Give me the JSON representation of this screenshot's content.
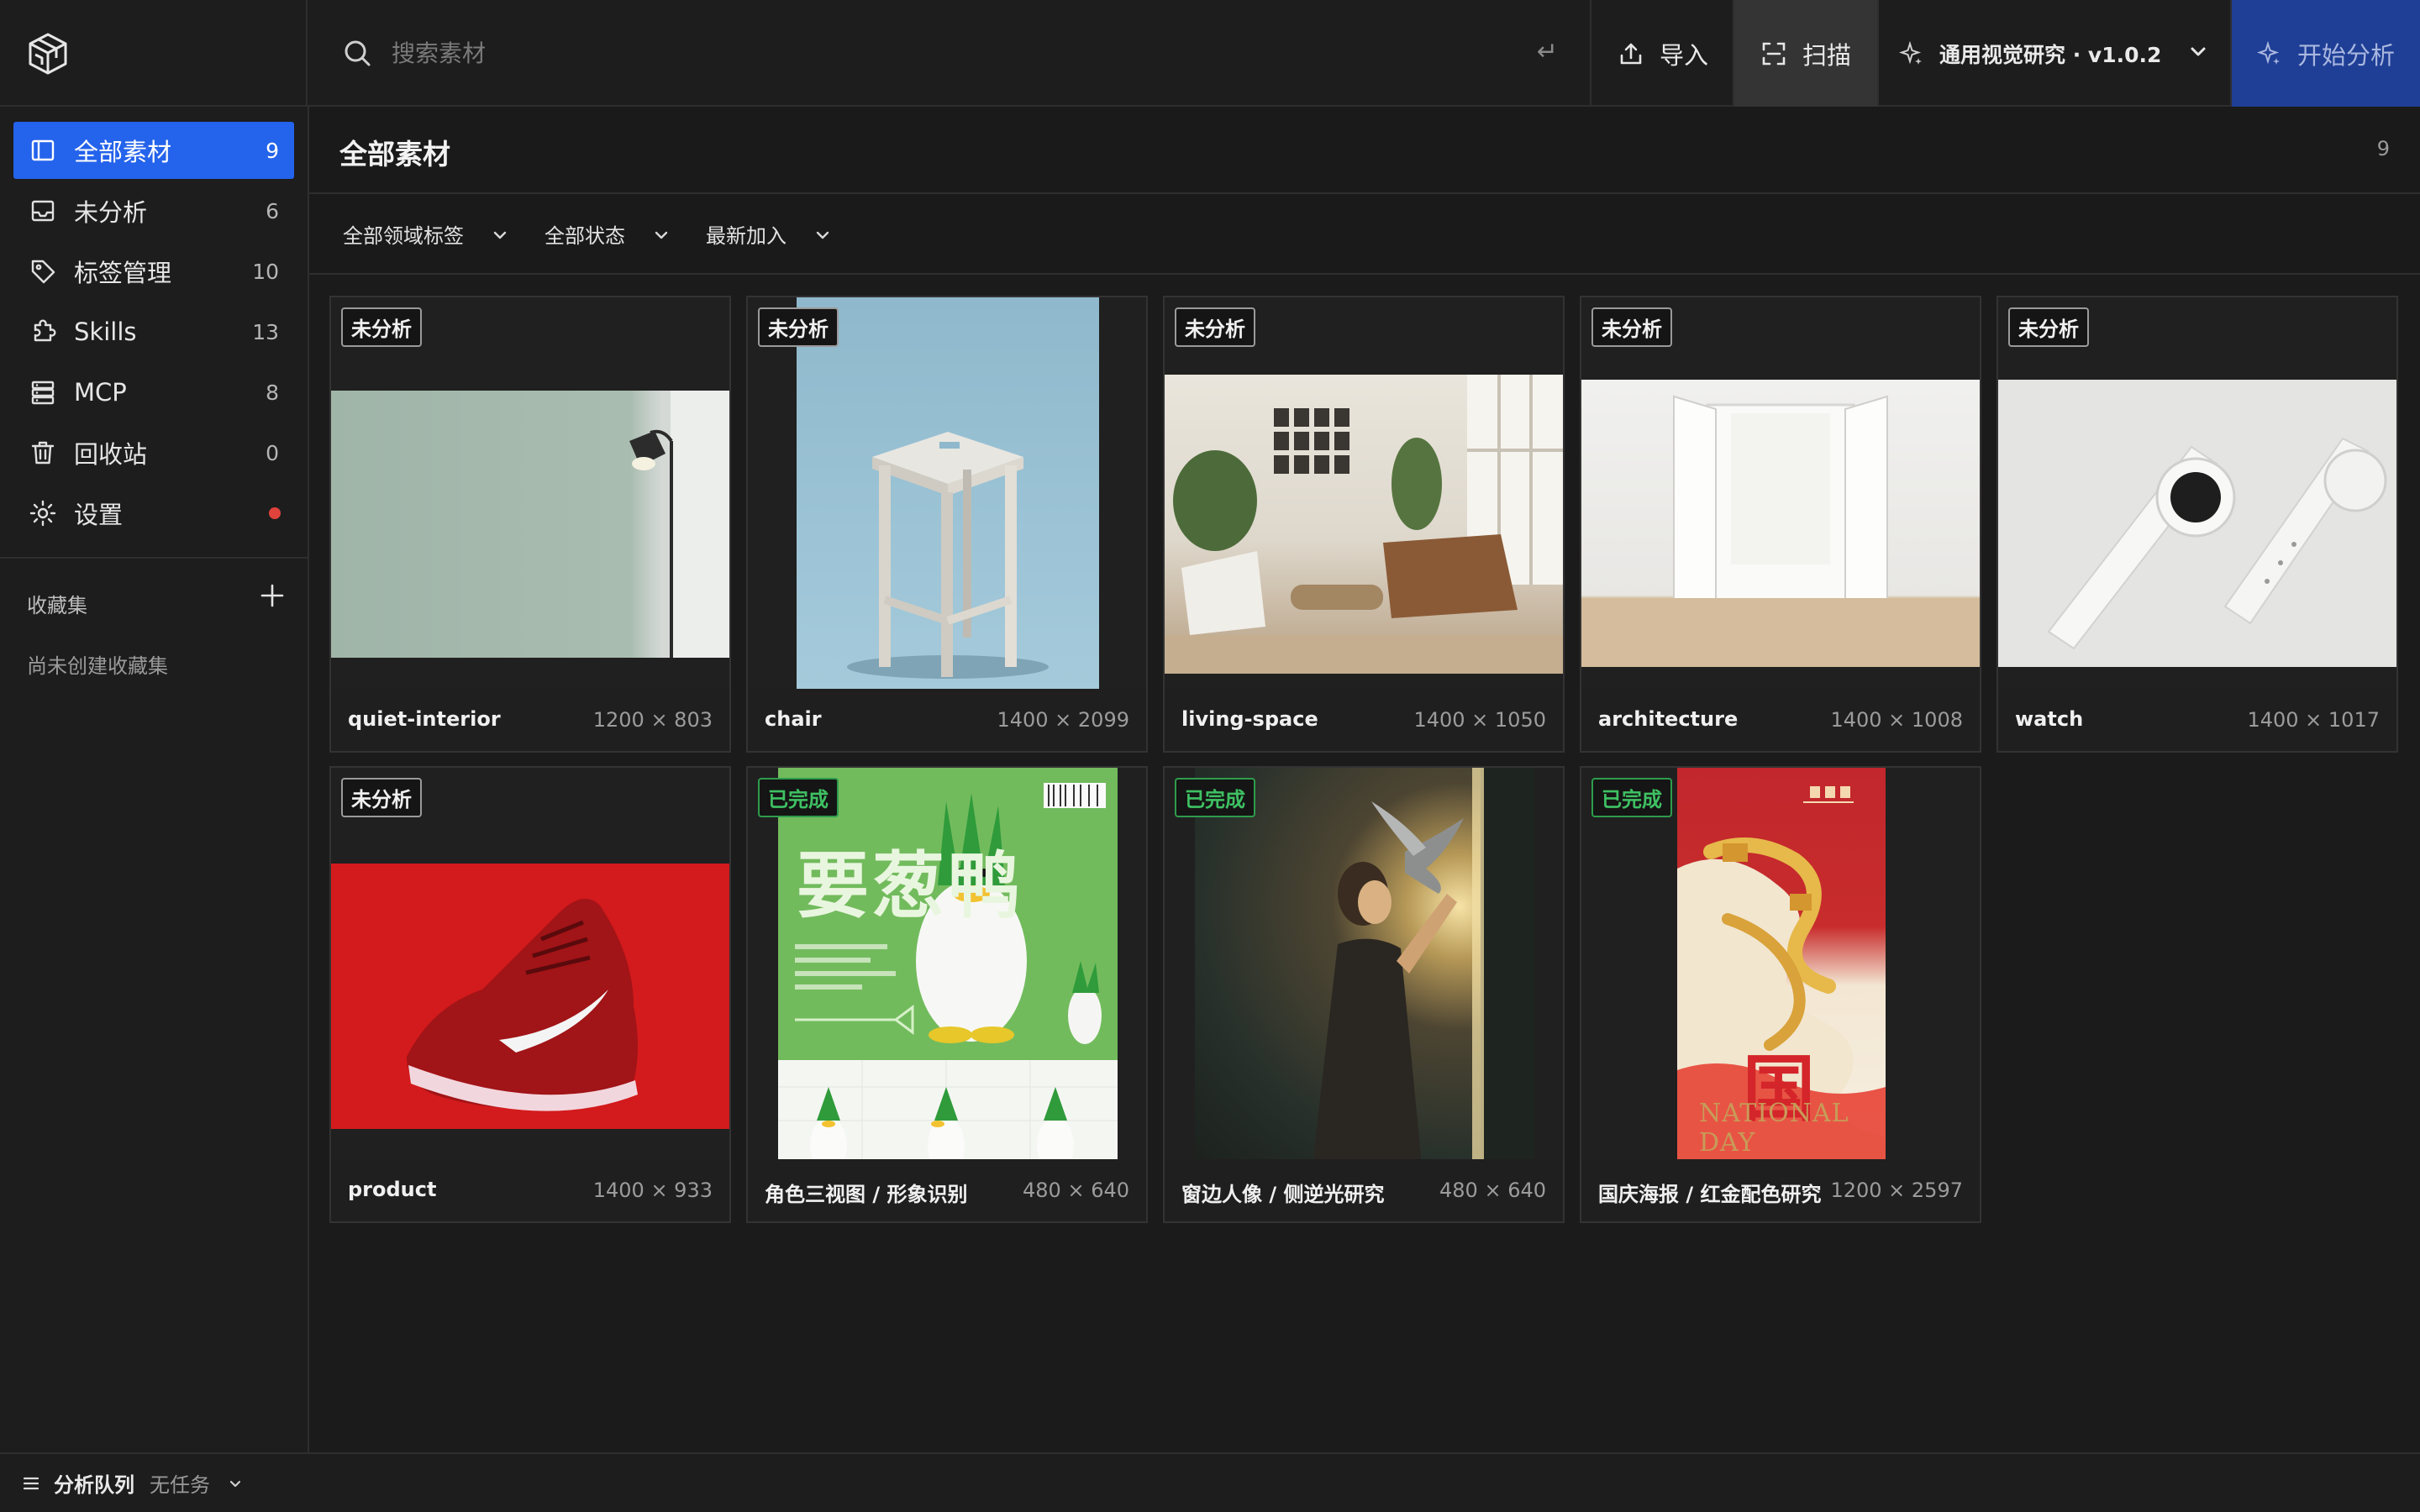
{
  "topbar": {
    "search_placeholder": "搜索素材",
    "enter_hint": "↵",
    "import_label": "导入",
    "scan_label": "扫描",
    "project_label": "通用视觉研究 · v1.0.2",
    "start_label": "开始分析"
  },
  "sidebar": {
    "items": [
      {
        "label": "全部素材",
        "count": "9",
        "icon": "library-icon"
      },
      {
        "label": "未分析",
        "count": "6",
        "icon": "inbox-icon"
      },
      {
        "label": "标签管理",
        "count": "10",
        "icon": "tag-icon"
      },
      {
        "label": "Skills",
        "count": "13",
        "icon": "puzzle-icon"
      },
      {
        "label": "MCP",
        "count": "8",
        "icon": "server-icon"
      },
      {
        "label": "回收站",
        "count": "0",
        "icon": "trash-icon"
      },
      {
        "label": "设置",
        "count": "",
        "icon": "gear-icon"
      }
    ],
    "collections_title": "收藏集",
    "collections_empty": "尚未创建收藏集"
  },
  "main": {
    "title": "全部素材",
    "count": "9",
    "filters": [
      "全部领域标签",
      "全部状态",
      "最新加入"
    ]
  },
  "cards": [
    {
      "status": "未分析",
      "name": "quiet-interior",
      "dims": "1200 × 803"
    },
    {
      "status": "未分析",
      "name": "chair",
      "dims": "1400 × 2099"
    },
    {
      "status": "未分析",
      "name": "living-space",
      "dims": "1400 × 1050"
    },
    {
      "status": "未分析",
      "name": "architecture",
      "dims": "1400 × 1008"
    },
    {
      "status": "未分析",
      "name": "watch",
      "dims": "1400 × 1017"
    },
    {
      "status": "未分析",
      "name": "product",
      "dims": "1400 × 933"
    },
    {
      "status": "已完成",
      "name": "角色三视图 / 形象识别",
      "dims": "480 × 640",
      "poster_text": "要葱鸭"
    },
    {
      "status": "已完成",
      "name": "窗边人像 / 侧逆光研究",
      "dims": "480 × 640"
    },
    {
      "status": "已完成",
      "name": "国庆海报 / 红金配色研究",
      "dims": "1200 × 2597",
      "poster_text": "NATIONAL DAY"
    }
  ],
  "bottombar": {
    "queue_title": "分析队列",
    "queue_status": "无任务"
  },
  "colors": {
    "accent": "#2463eb",
    "start_button": "#1f3f96",
    "done": "#3fc163",
    "alert_dot": "#e0433b"
  }
}
